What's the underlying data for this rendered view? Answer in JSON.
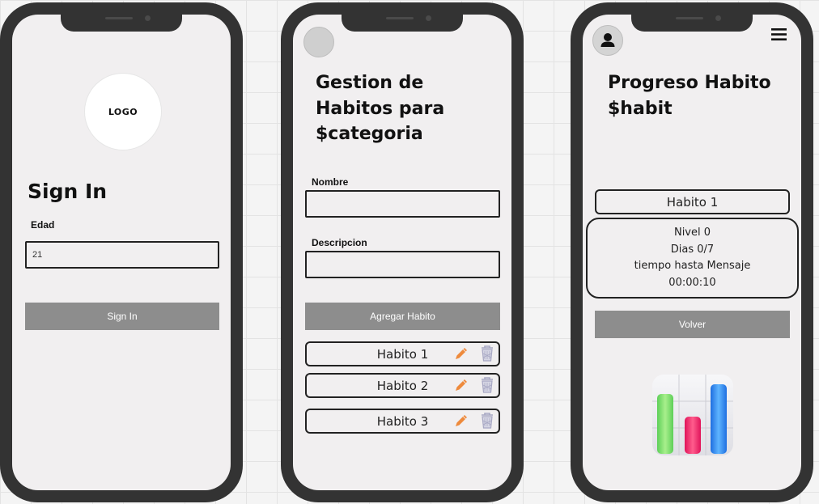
{
  "screen_signin": {
    "logo_text": "LOGO",
    "title": "Sign In",
    "age_label": "Edad",
    "age_value": "21",
    "signin_button": "Sign In"
  },
  "screen_habits": {
    "title_line1": "Gestion de",
    "title_line2": "Habitos para",
    "title_line3": "$categoria",
    "name_label": "Nombre",
    "description_label": "Descripcion",
    "add_button": "Agregar Habito",
    "habits": [
      {
        "label": "Habito 1"
      },
      {
        "label": "Habito 2"
      },
      {
        "label": "Habito 3"
      }
    ],
    "icons": {
      "edit": "pencil-icon",
      "delete": "trash-icon"
    }
  },
  "screen_progress": {
    "title_line1": "Progreso Habito",
    "title_line2": "$habit",
    "habit_name": "Habito 1",
    "level": "Nivel 0",
    "days": "Dias 0/7",
    "time_label": "tiempo hasta Mensaje",
    "time_value": "00:00:10",
    "back_button": "Volver",
    "icons": {
      "user": "user-icon",
      "menu": "hamburger-menu-icon",
      "stats": "bar-chart-icon"
    }
  },
  "colors": {
    "phone_frame": "#333333",
    "screen_bg": "#f1eff0",
    "button_bg": "#8d8d8d",
    "edit_icon": "#ee8a3c",
    "delete_icon": "#a8a8c4"
  }
}
